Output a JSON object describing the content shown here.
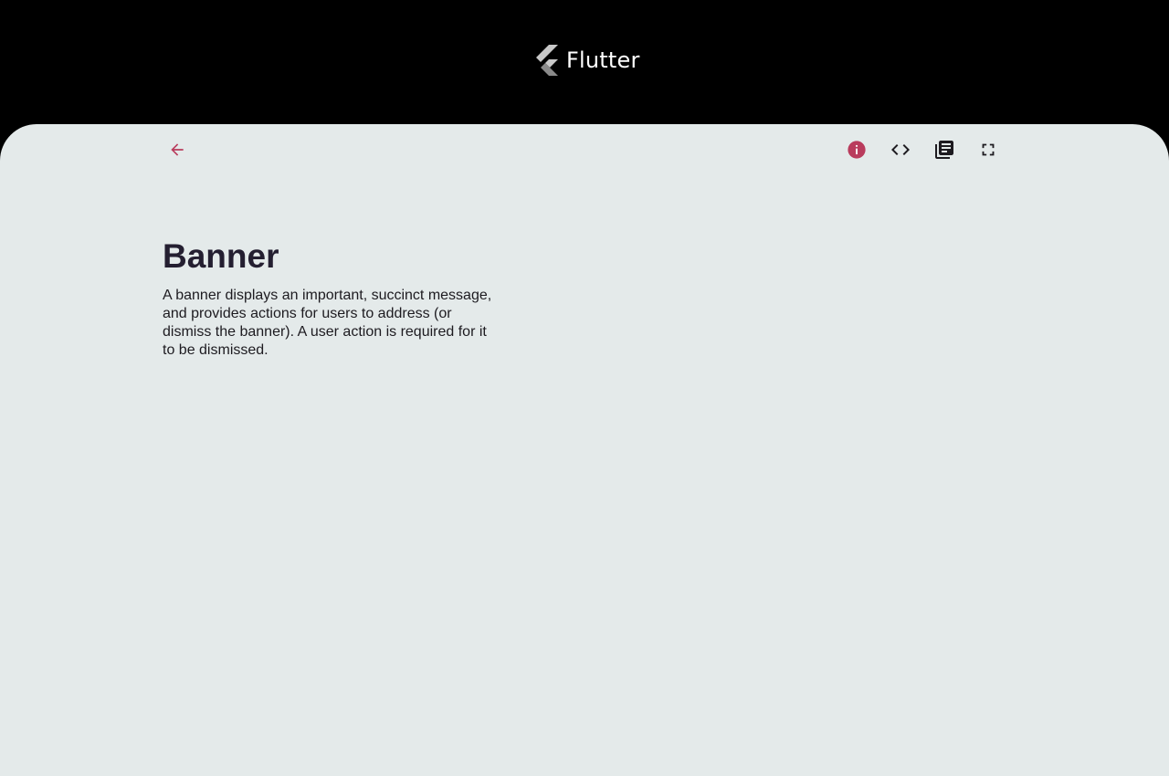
{
  "header": {
    "logo_text": "Flutter"
  },
  "toolbar": {
    "icons": {
      "back": "arrow-back-icon",
      "info": "info-icon",
      "code": "code-icon",
      "docs": "library-books-icon",
      "fullscreen": "fullscreen-icon"
    }
  },
  "demo": {
    "title": "Banner",
    "description": "A banner displays an important, succinct message, and provides actions for users to address (or dismiss the banner). A user action is required for it to be dismissed."
  },
  "colors": {
    "background": "#000000",
    "panel": "#e4eaea",
    "accent": "#b93c5d",
    "icon_dark": "#1d1b20",
    "title": "#241f31"
  }
}
